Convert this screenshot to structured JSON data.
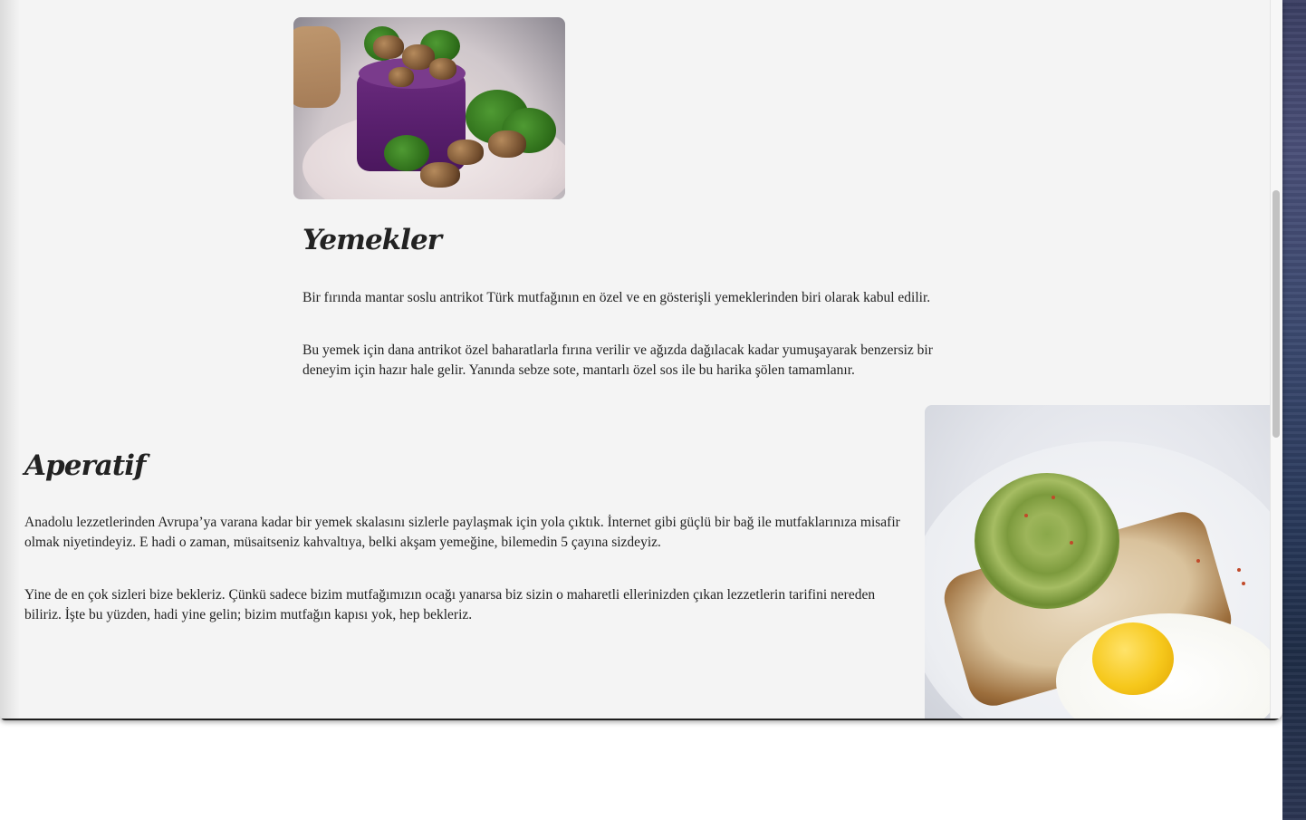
{
  "yemekler": {
    "title": "Yemekler",
    "paragraphs": [
      "Bir fırında mantar soslu antrikot Türk mutfağının en özel ve en gösterişli yemeklerinden biri olarak kabul edilir.",
      "Bu yemek için dana antrikot özel baharatlarla fırına verilir ve ağızda dağılacak kadar yumuşayarak benzersiz bir deneyim için hazır hale gelir. Yanında sebze sote, mantarlı özel sos ile bu harika şölen tamamlanır."
    ]
  },
  "aperatif": {
    "title": "Aperatif",
    "paragraphs": [
      "Anadolu lezzetlerinden Avrupa’ya varana kadar bir yemek skalasını sizlerle paylaşmak için yola çıktık. İnternet gibi güçlü bir bağ ile mutfaklarınıza misafir olmak niyetindeyiz. E hadi o zaman, müsaitseniz kahvaltıya, belki akşam yemeğine, bilemedin 5 çayına sizdeyiz.",
      "Yine de en çok sizleri bize bekleriz. Çünkü sadece bizim mutfağımızın ocağı yanarsa biz sizin o maharetli ellerinizden çıkan lezzetlerin tarifini nereden biliriz. İşte bu yüzden, hadi yine gelin; bizim mutfağın kapısı yok, hep bekleriz."
    ]
  },
  "colors": {
    "page_background": "#f4f4f4",
    "text": "#222222"
  }
}
